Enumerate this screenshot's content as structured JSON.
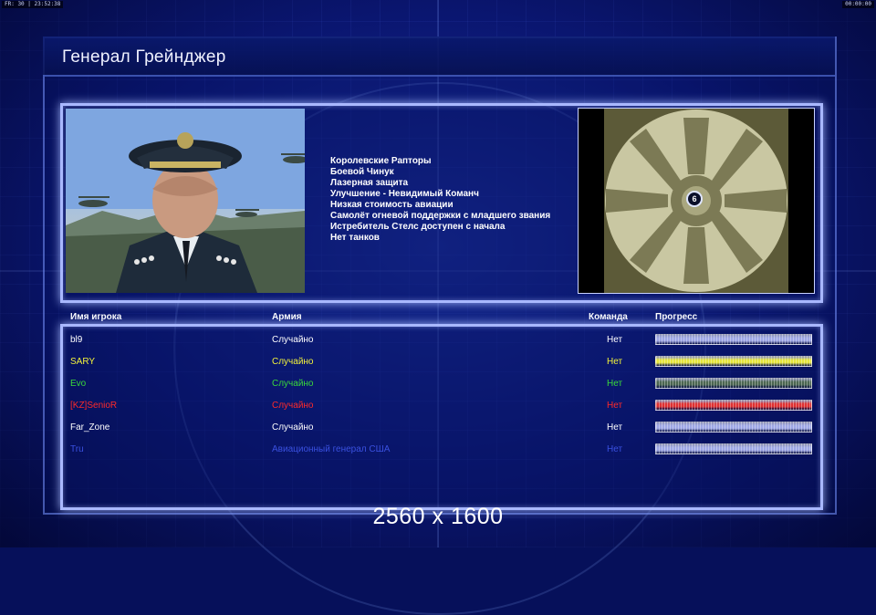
{
  "status_left": "FR: 30 | 23:52:38",
  "status_right": "00:00:00",
  "title": "Генерал Грейнджер",
  "traits": [
    "Королевские Рапторы",
    "Боевой Чинук",
    "Лазерная защита",
    "Улучшение - Невидимый Команч",
    "Низкая стоимость авиации",
    "Самолёт огневой поддержки с младшего звания",
    "Истребитель Стелс доступен с начала",
    "Нет танков"
  ],
  "map": {
    "start_marker": "6"
  },
  "columns": {
    "name": "Имя игрока",
    "army": "Армия",
    "team": "Команда",
    "progress": "Прогресс"
  },
  "players": [
    {
      "name": "bl9",
      "army": "Случайно",
      "team": "Нет",
      "color": "#ffffff",
      "bar_color": "#9fa8e6"
    },
    {
      "name": "SARY",
      "army": "Случайно",
      "team": "Нет",
      "color": "#f2f23a",
      "bar_color": "#e6e63c"
    },
    {
      "name": "Evo",
      "army": "Случайно",
      "team": "Нет",
      "color": "#3ad83a",
      "bar_color": "#4b6650"
    },
    {
      "name": "[KZ]SenioR",
      "army": "Случайно",
      "team": "Нет",
      "color": "#ff2a2a",
      "bar_color": "#e03030"
    },
    {
      "name": "Far_Zone",
      "army": "Случайно",
      "team": "Нет",
      "color": "#ffffff",
      "bar_color": "#9fa8e6"
    },
    {
      "name": "Tru",
      "army": "Авиационный генерал США",
      "team": "Нет",
      "color": "#3a50e0",
      "bar_color": "#9fa8e6"
    }
  ],
  "resolution_label": "2560 x 1600"
}
